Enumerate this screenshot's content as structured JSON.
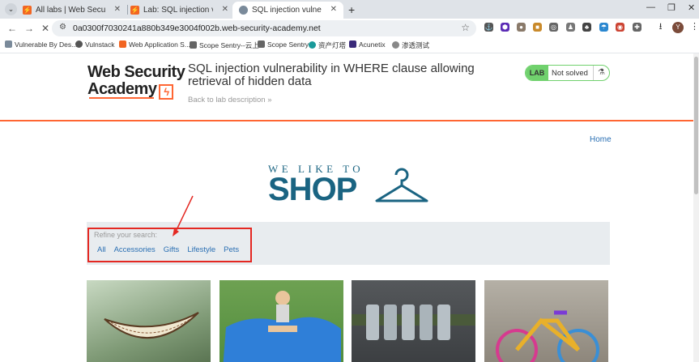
{
  "browser": {
    "tabs": [
      {
        "title": "All labs | Web Security Acade",
        "active": false
      },
      {
        "title": "Lab: SQL injection vulnerabili",
        "active": false
      },
      {
        "title": "SQL injection vulnerability in",
        "active": true
      }
    ],
    "url": "0a0300f7030241a880b349e3004f002b.web-security-academy.net",
    "profile_initial": "Y",
    "bookmarks": [
      "Vulnerable By Des...",
      "Vulnstack",
      "Web Application S...",
      "Scope Sentry--云上",
      "Scope Sentry",
      "资产灯塔",
      "Acunetix",
      "渗透测试"
    ]
  },
  "lab": {
    "logo_line1": "Web Security",
    "logo_line2": "Academy",
    "title": "SQL injection vulnerability in WHERE clause allowing retrieval of hidden data",
    "back_link": "Back to lab description",
    "badge_label": "LAB",
    "status": "Not solved"
  },
  "nav": {
    "home": "Home"
  },
  "hero": {
    "line1": "WE LIKE TO",
    "line2": "SHOP"
  },
  "search": {
    "refine_label": "Refine your search:",
    "categories": [
      "All",
      "Accessories",
      "Gifts",
      "Lifestyle",
      "Pets"
    ]
  },
  "colors": {
    "brand_orange": "#ff6633",
    "link_blue": "#2a6fb3",
    "shop_teal": "#1a6482",
    "annotation_red": "#e42822",
    "status_green": "#70d16d"
  }
}
